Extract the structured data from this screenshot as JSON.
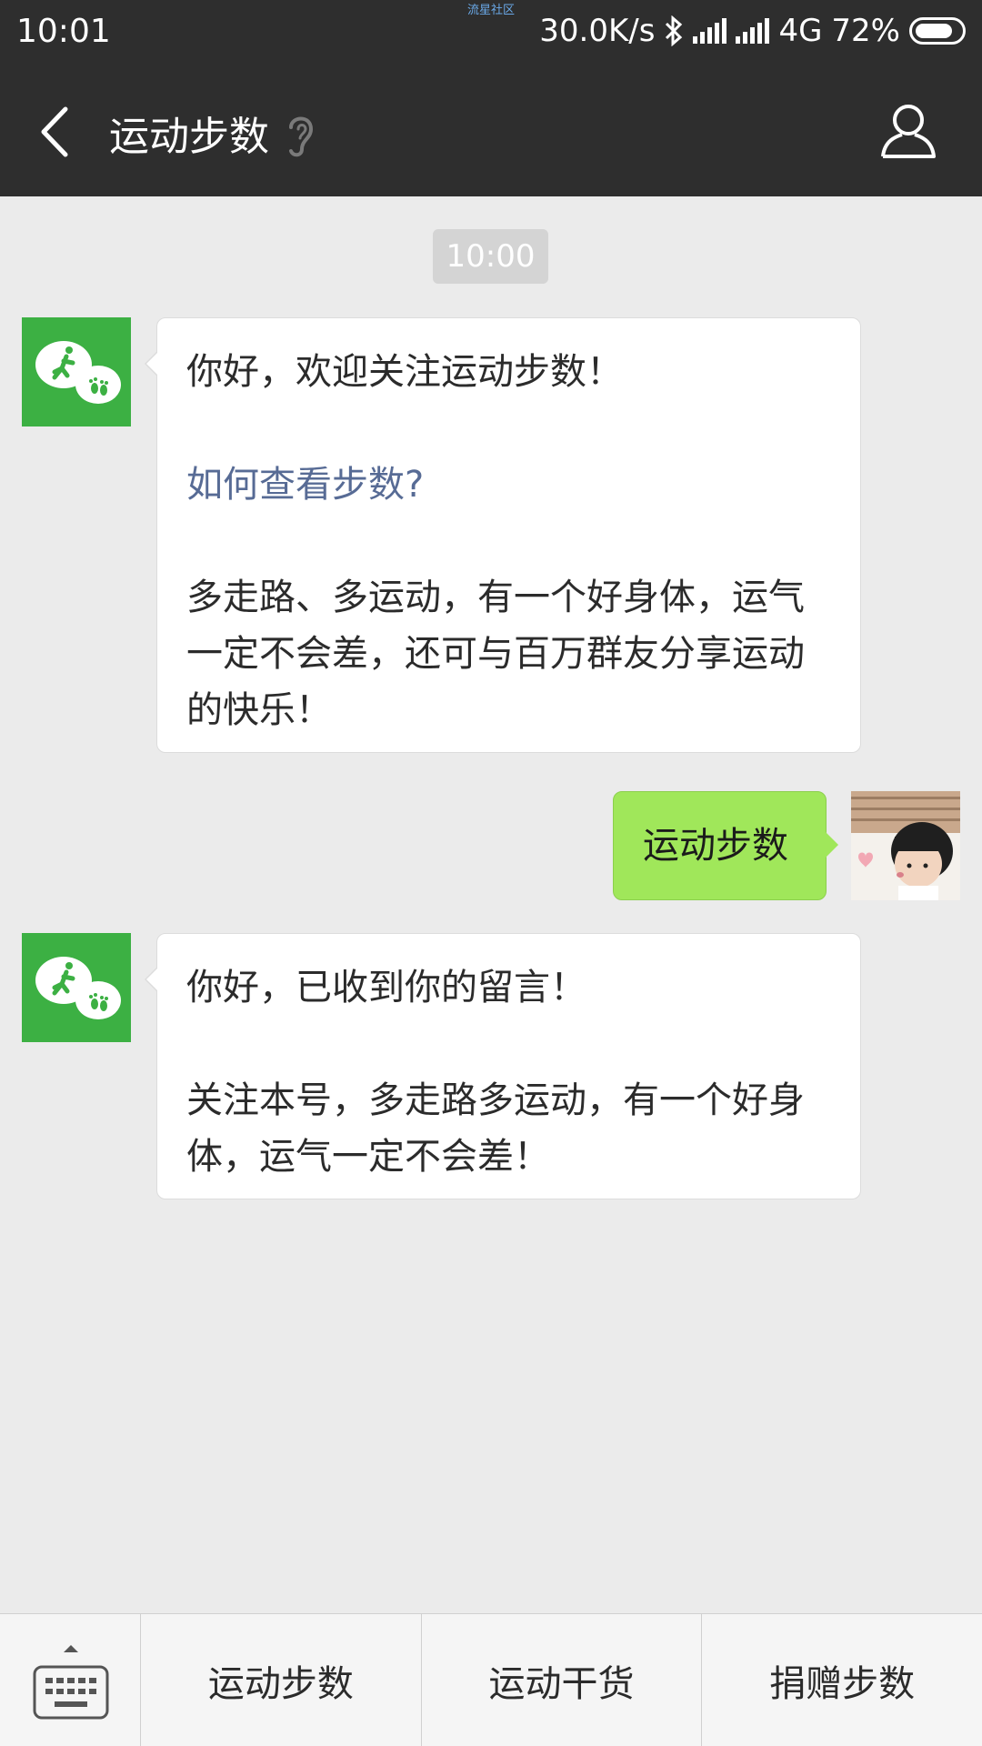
{
  "status_bar": {
    "time": "10:01",
    "watermark": "流星社区",
    "network_speed": "30.0K/s",
    "network_type": "4G",
    "battery": "72%"
  },
  "header": {
    "title": "运动步数"
  },
  "chat": {
    "timestamp": "10:00",
    "messages": [
      {
        "from": "bot",
        "greeting": "你好，欢迎关注运动步数！",
        "link": "如何查看步数?",
        "body": "多走路、多运动，有一个好身体，运气一定不会差，还可与百万群友分享运动的快乐！"
      },
      {
        "from": "user",
        "text": "运动步数"
      },
      {
        "from": "bot",
        "greeting": "你好，已收到你的留言！",
        "body": "关注本号，多走路多运动，有一个好身体，运气一定不会差！"
      }
    ]
  },
  "bottom_menu": {
    "items": [
      "运动步数",
      "运动干货",
      "捐赠步数"
    ]
  },
  "colors": {
    "bar_bg": "#2e2e2e",
    "chat_bg": "#ebebeb",
    "bot_avatar": "#3cb043",
    "user_bubble": "#a0e75a",
    "link": "#576b95"
  },
  "icons": [
    "back-arrow-icon",
    "ear-icon",
    "profile-icon",
    "bluetooth-icon",
    "signal-icon",
    "battery-icon",
    "keyboard-icon",
    "runner-icon",
    "footprint-icon"
  ]
}
